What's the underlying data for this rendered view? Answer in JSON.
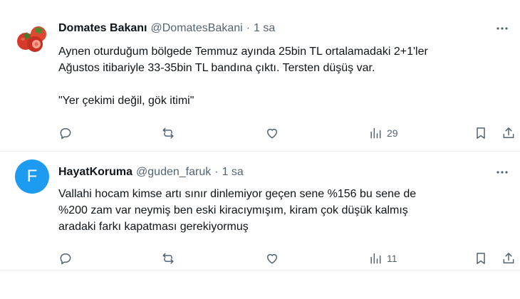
{
  "tweets": [
    {
      "name": "Domates Bakanı",
      "handle": "@DomatesBakani",
      "separator": "·",
      "time": "1 sa",
      "text_lines": [
        "Aynen oturduğum bölgede Temmuz ayında 25bin TL ortalamadaki 2+1'ler",
        "Ağustos itibariyle 33-35bin TL bandına çıktı. Tersten düşüş var.",
        "",
        "\"Yer çekimi değil, gök itimi\""
      ],
      "views": "29",
      "avatar_icon": "tomato-avatar"
    },
    {
      "name": "HayatKoruma",
      "handle": "@guden_faruk",
      "separator": "·",
      "time": "1 sa",
      "avatar_letter": "F",
      "text_lines": [
        "Vallahi hocam kimse artı sınır dinlemiyor geçen sene %156 bu sene de",
        "%200 zam var neymiş ben eski kiracıymışım, kiram çok düşük kalmış",
        "aradaki farkı kapatması gerekiyormuş"
      ],
      "views": "11"
    }
  ],
  "colors": {
    "text": "#0f1419",
    "secondary": "#536471",
    "avatar_bg": "#1d9bf0",
    "divider": "#eff3f4"
  }
}
